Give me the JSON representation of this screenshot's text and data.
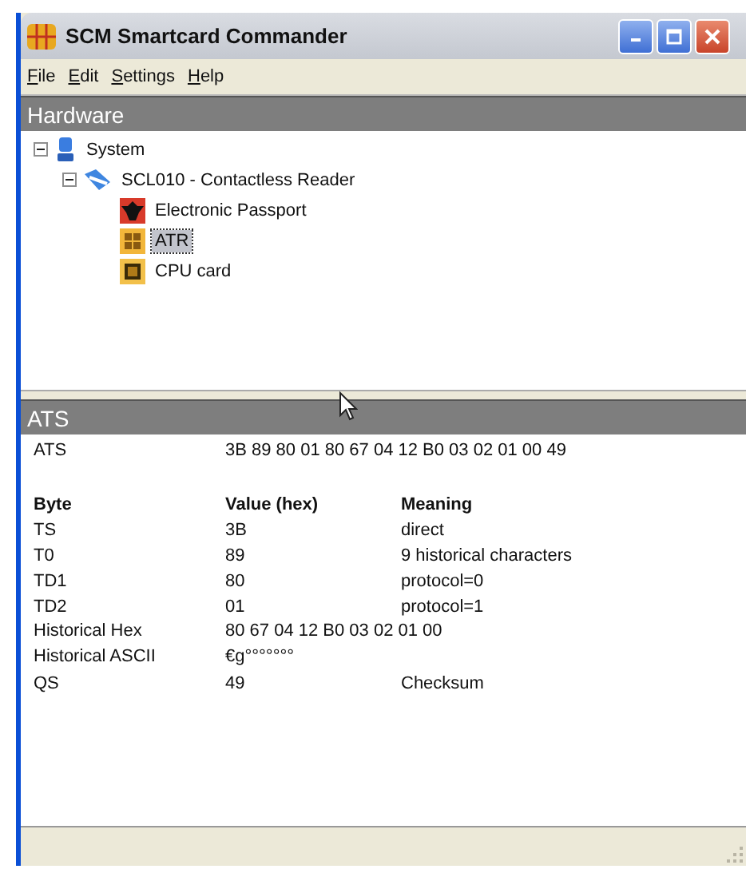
{
  "window": {
    "title": "SCM Smartcard Commander"
  },
  "menu": [
    {
      "label": "File"
    },
    {
      "label": "Edit"
    },
    {
      "label": "Settings"
    },
    {
      "label": "Help"
    }
  ],
  "hardware": {
    "title": "Hardware",
    "tree": [
      {
        "label": "System",
        "kind": "computer",
        "expanded": true,
        "selected": false,
        "children": [
          {
            "label": "SCL010 - Contactless Reader",
            "kind": "reader",
            "expanded": true,
            "selected": false,
            "children": [
              {
                "label": "Electronic Passport",
                "kind": "eagle",
                "selected": false
              },
              {
                "label": "ATR",
                "kind": "chipcard",
                "selected": true
              },
              {
                "label": "CPU card",
                "kind": "cpu",
                "selected": false
              }
            ]
          }
        ]
      }
    ]
  },
  "ats": {
    "title": "ATS",
    "summary": {
      "label": "ATS",
      "value": "3B 89 80 01 80 67 04 12 B0 03 02 01 00 49"
    },
    "columns": [
      "Byte",
      "Value (hex)",
      "Meaning"
    ],
    "rows": [
      [
        "TS",
        "3B",
        "direct"
      ],
      [
        "T0",
        "89",
        "9 historical characters"
      ],
      [
        "TD1",
        "80",
        "protocol=0"
      ],
      [
        "TD2",
        "01",
        "protocol=1"
      ],
      [
        "Historical Hex",
        "80 67 04 12 B0 03 02 01 00",
        ""
      ],
      [
        "Historical ASCII",
        "€g°°°°°°°",
        ""
      ],
      [
        "QS",
        "49",
        "Checksum"
      ]
    ]
  }
}
